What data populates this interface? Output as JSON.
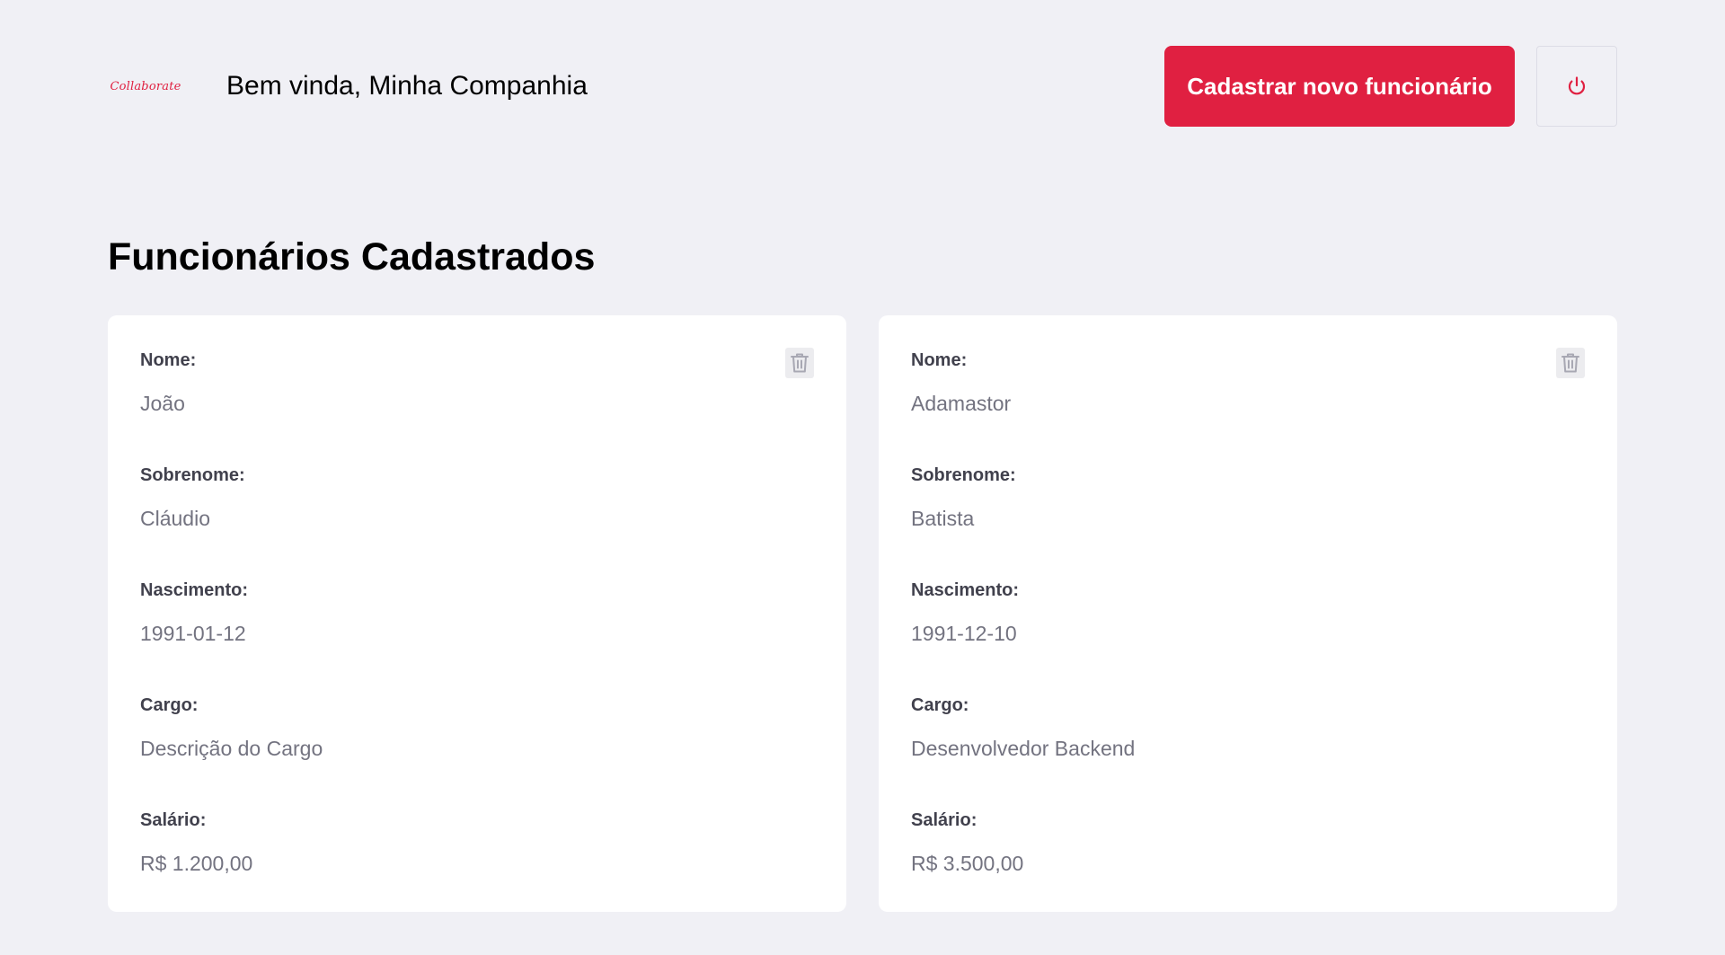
{
  "header": {
    "logo_text": "Collaborate",
    "welcome": "Bem vinda, Minha Companhia",
    "new_button_label": "Cadastrar novo funcionário",
    "logout_icon": "power-icon"
  },
  "main": {
    "section_title": "Funcionários Cadastrados",
    "labels": {
      "nome": "Nome:",
      "sobrenome": "Sobrenome:",
      "nascimento": "Nascimento:",
      "cargo": "Cargo:",
      "salario": "Salário:"
    },
    "employees": [
      {
        "nome": "João",
        "sobrenome": "Cláudio",
        "nascimento": "1991-01-12",
        "cargo": "Descrição do Cargo",
        "salario": "R$ 1.200,00"
      },
      {
        "nome": "Adamastor",
        "sobrenome": "Batista",
        "nascimento": "1991-12-10",
        "cargo": "Desenvolvedor Backend",
        "salario": "R$ 3.500,00"
      }
    ]
  },
  "colors": {
    "accent": "#e02041",
    "background": "#f0f0f5",
    "card": "#ffffff",
    "label": "#41414d",
    "value": "#737380"
  },
  "icons": {
    "delete": "trash-icon",
    "logout": "power-icon"
  }
}
